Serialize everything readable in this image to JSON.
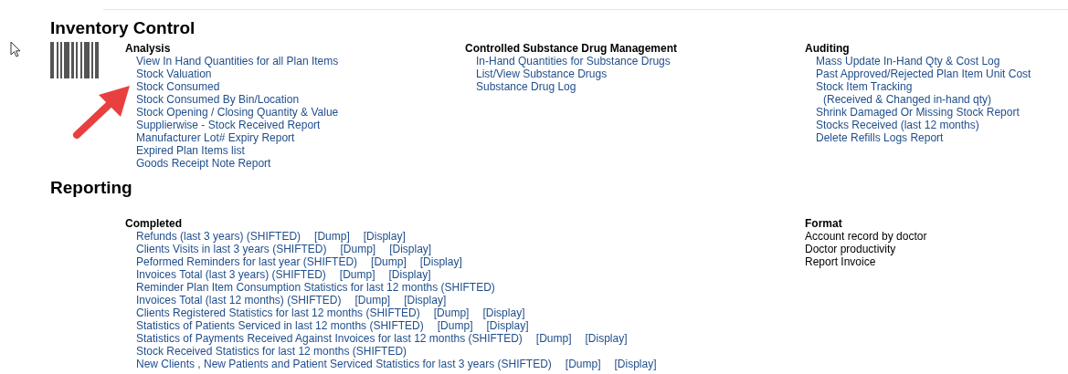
{
  "inventory": {
    "title": "Inventory Control",
    "groups": [
      {
        "heading": "Analysis",
        "items": [
          {
            "kind": "link",
            "label": "View In Hand Quantities for all Plan Items"
          },
          {
            "kind": "link",
            "label": "Stock Valuation"
          },
          {
            "kind": "link",
            "label": "Stock Consumed"
          },
          {
            "kind": "link",
            "label": "Stock Consumed By Bin/Location"
          },
          {
            "kind": "link",
            "label": "Stock Opening / Closing Quantity & Value"
          },
          {
            "kind": "link",
            "label": "Supplierwise - Stock Received Report"
          },
          {
            "kind": "link",
            "label": "Manufacturer Lot# Expiry Report"
          },
          {
            "kind": "link",
            "label": "Expired Plan Items list"
          },
          {
            "kind": "link",
            "label": "Goods Receipt Note Report"
          }
        ]
      },
      {
        "heading": "Controlled Substance Drug Management",
        "items": [
          {
            "kind": "link",
            "label": "In-Hand Quantities for Substance Drugs"
          },
          {
            "kind": "link",
            "label": "List/View Substance Drugs"
          },
          {
            "kind": "link",
            "label": "Substance Drug Log"
          }
        ]
      },
      {
        "heading": "Auditing",
        "items": [
          {
            "kind": "link",
            "label": "Mass Update In-Hand Qty & Cost Log"
          },
          {
            "kind": "link",
            "label": "Past Approved/Rejected Plan Item Unit Cost"
          },
          {
            "kind": "link",
            "label": "Stock Item Tracking"
          },
          {
            "kind": "note",
            "label": "(Received & Changed in-hand qty)"
          },
          {
            "kind": "link",
            "label": "Shrink Damaged Or Missing Stock Report"
          },
          {
            "kind": "link",
            "label": "Stocks Received (last 12 months)"
          },
          {
            "kind": "link",
            "label": "Delete Refills Logs Report"
          }
        ]
      }
    ]
  },
  "reporting": {
    "title": "Reporting",
    "completed": {
      "heading": "Completed",
      "rows": [
        {
          "label": "Refunds (last 3 years) (SHIFTED)",
          "actions": [
            "[Dump]",
            "[Display]"
          ]
        },
        {
          "label": "Clients Visits in last 3 years (SHIFTED)",
          "actions": [
            "[Dump]",
            "[Display]"
          ]
        },
        {
          "label": "Peformed Reminders for last year (SHIFTED)",
          "actions": [
            "[Dump]",
            "[Display]"
          ]
        },
        {
          "label": "Invoices Total (last 3 years) (SHIFTED)",
          "actions": [
            "[Dump]",
            "[Display]"
          ]
        },
        {
          "label": "Reminder Plan Item Consumption Statistics for last 12 months (SHIFTED)"
        },
        {
          "label": "Invoices Total (last 12 months) (SHIFTED)",
          "actions": [
            "[Dump]",
            "[Display]"
          ]
        },
        {
          "label": "Clients Registered Statistics for last 12 months (SHIFTED)",
          "actions": [
            "[Dump]",
            "[Display]"
          ]
        },
        {
          "label": "Statistics of Patients Serviced in last 12 months (SHIFTED)",
          "actions": [
            "[Dump]",
            "[Display]"
          ]
        },
        {
          "label": "Statistics of Payments Received Against Invoices for last 12 months (SHIFTED)",
          "actions": [
            "[Dump]",
            "[Display]"
          ]
        },
        {
          "label": "Stock Received Statistics for last 12 months (SHIFTED)"
        },
        {
          "label": "New Clients , New Patients and Patient Serviced Statistics for last 3 years (SHIFTED)",
          "actions": [
            "[Dump]",
            "[Display]"
          ]
        }
      ]
    },
    "format": {
      "heading": "Format",
      "items": [
        "Account record by doctor",
        "Doctor productivity",
        "Report Invoice"
      ]
    }
  }
}
